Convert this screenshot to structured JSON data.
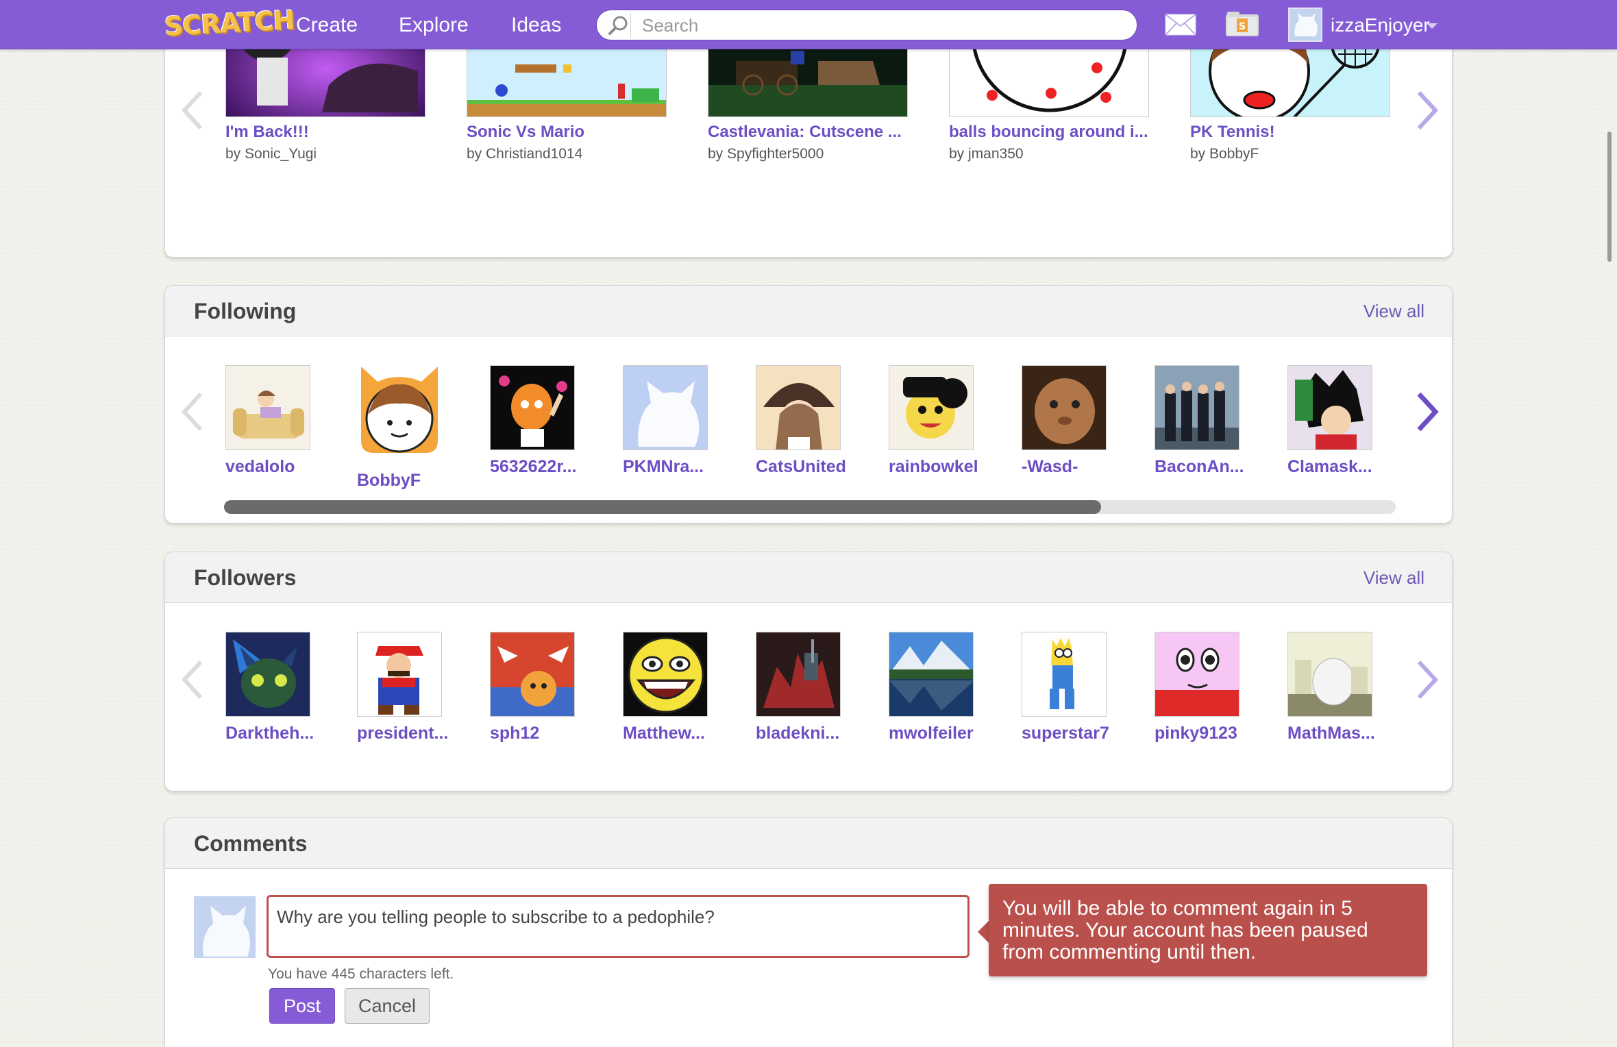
{
  "nav": {
    "logo": "SCRATCH",
    "links": [
      "Create",
      "Explore",
      "Ideas"
    ],
    "search_placeholder": "Search",
    "username": "izzaEnjoyer"
  },
  "projects": [
    {
      "title": "I'm Back!!!",
      "by": "by Sonic_Yugi"
    },
    {
      "title": "Sonic Vs Mario",
      "by": "by Christiand1014"
    },
    {
      "title": "Castlevania: Cutscene ...",
      "by": "by Spyfighter5000"
    },
    {
      "title": "balls bouncing around i...",
      "by": "by jman350"
    },
    {
      "title": "PK Tennis!",
      "by": "by BobbyF"
    }
  ],
  "following": {
    "title": "Following",
    "view_all": "View all",
    "users": [
      "vedalolo",
      "BobbyF",
      "5632622r...",
      "PKMNra...",
      "CatsUnited",
      "rainbowkel",
      "-Wasd-",
      "BaconAn...",
      "Clamask..."
    ]
  },
  "followers": {
    "title": "Followers",
    "view_all": "View all",
    "users": [
      "Darktheh...",
      "president...",
      "sph12",
      "Matthew...",
      "bladekni...",
      "mwolfeiler",
      "superstar7",
      "pinky9123",
      "MathMas..."
    ]
  },
  "comments": {
    "title": "Comments",
    "input_value": "Why are you telling people to subscribe to a pedophile?",
    "error": "You will be able to comment again in 5 minutes. Your account has been paused from commenting until then.",
    "remaining": "You have 445 characters left.",
    "post": "Post",
    "cancel": "Cancel"
  },
  "colors": {
    "nav": "#855cd6",
    "link": "#6d4ec4",
    "error": "#b9504c"
  }
}
